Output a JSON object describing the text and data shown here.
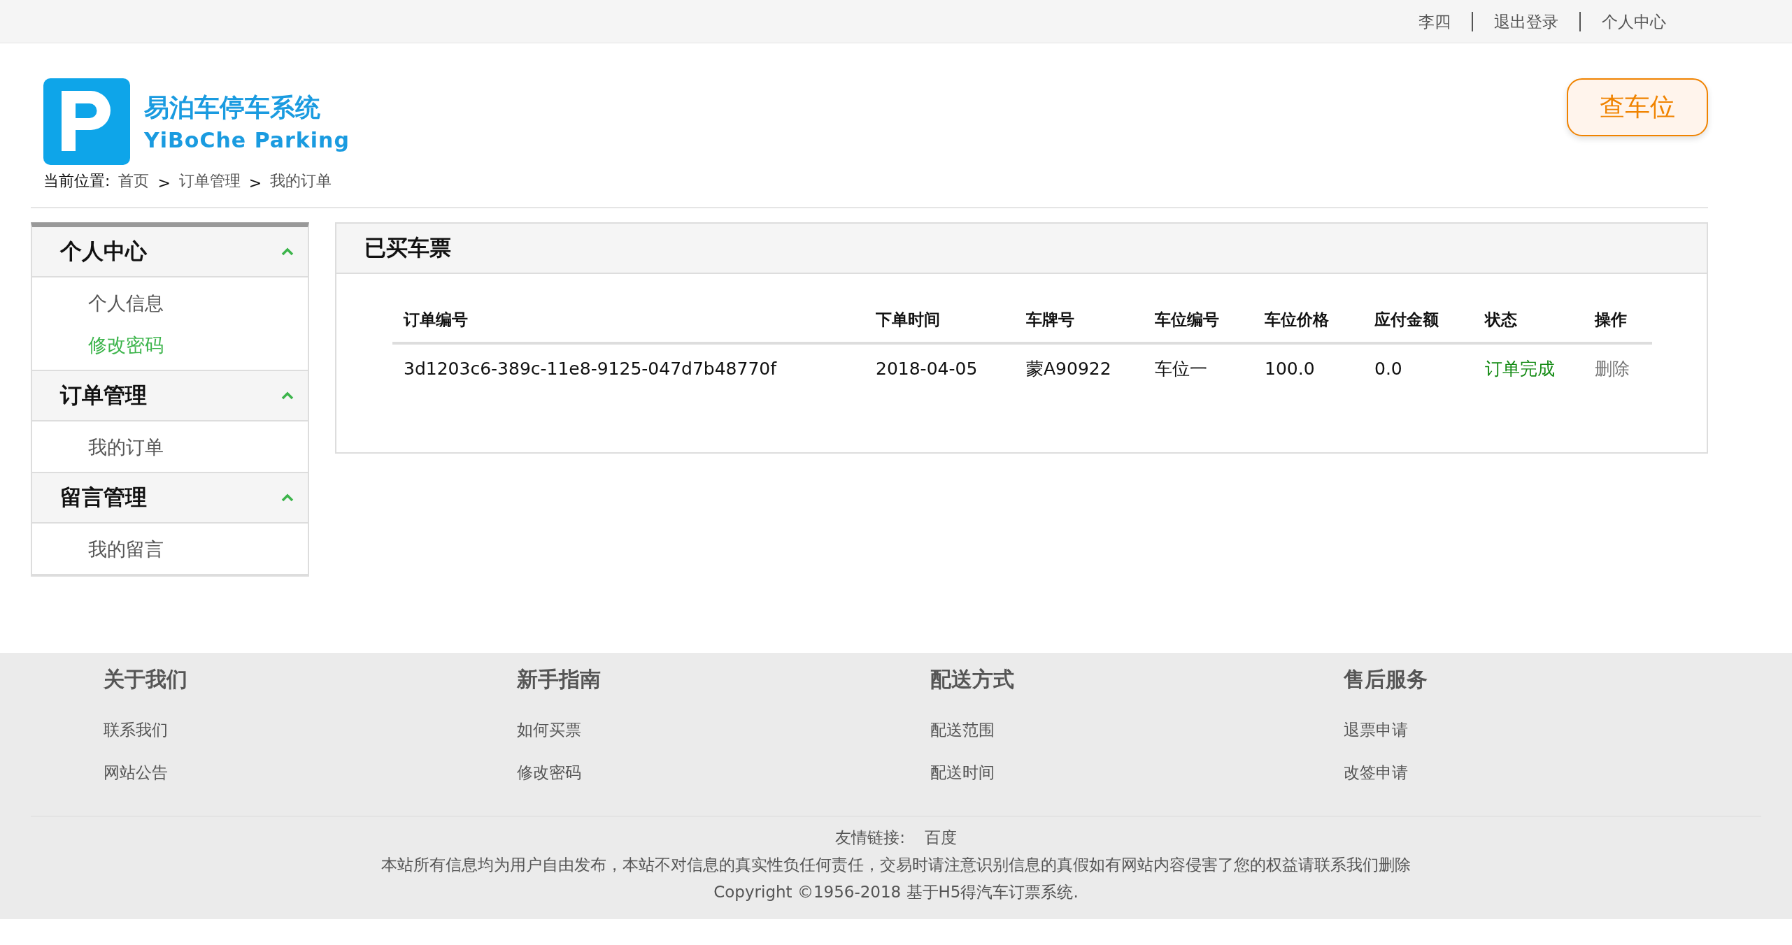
{
  "top_bar": {
    "links": [
      "李四",
      "退出登录",
      "个人中心"
    ]
  },
  "logo": {
    "title": "易泊车停车系统",
    "subtitle": "YiBoChe Parking"
  },
  "search_button": "查车位",
  "breadcrumb": {
    "label": "当前位置:",
    "items": [
      "首页",
      "订单管理",
      "我的订单"
    ],
    "separator": ">"
  },
  "sidebar": {
    "sections": [
      {
        "title": "个人中心",
        "expanded": true,
        "items": [
          {
            "label": "个人信息",
            "selected": false
          },
          {
            "label": "修改密码",
            "selected": true
          }
        ]
      },
      {
        "title": "订单管理",
        "expanded": true,
        "items": [
          {
            "label": "我的订单",
            "selected": false
          }
        ]
      },
      {
        "title": "留言管理",
        "expanded": true,
        "items": [
          {
            "label": "我的留言",
            "selected": false
          }
        ]
      }
    ]
  },
  "panel": {
    "title": "已买车票",
    "table": {
      "columns": [
        "订单编号",
        "下单时间",
        "车牌号",
        "车位编号",
        "车位价格",
        "应付金额",
        "状态",
        "操作"
      ],
      "rows": [
        {
          "order_no": "3d1203c6-389c-11e8-9125-047d7b48770f",
          "date": "2018-04-05",
          "plate": "蒙A90922",
          "space": "车位一",
          "price": "100.0",
          "due": "0.0",
          "status": {
            "text": "订单完成",
            "kind": "done"
          },
          "action": "删除"
        }
      ]
    }
  },
  "footer": {
    "columns": [
      {
        "title": "关于我们",
        "links": [
          "联系我们",
          "网站公告"
        ]
      },
      {
        "title": "新手指南",
        "links": [
          "如何买票",
          "修改密码"
        ]
      },
      {
        "title": "配送方式",
        "links": [
          "配送范围",
          "配送时间"
        ]
      },
      {
        "title": "售后服务",
        "links": [
          "退票申请",
          "改签申请"
        ]
      }
    ],
    "friend_links": {
      "label": "友情链接:",
      "links": [
        "百度"
      ]
    },
    "disclaimer": "本站所有信息均为用户自由发布，本站不对信息的真实性负任何责任，交易时请注意识别信息的真假如有网站内容侵害了您的权益请联系我们删除",
    "copyright": "Copyright ©1956-2018 基于H5得汽车订票系统."
  }
}
